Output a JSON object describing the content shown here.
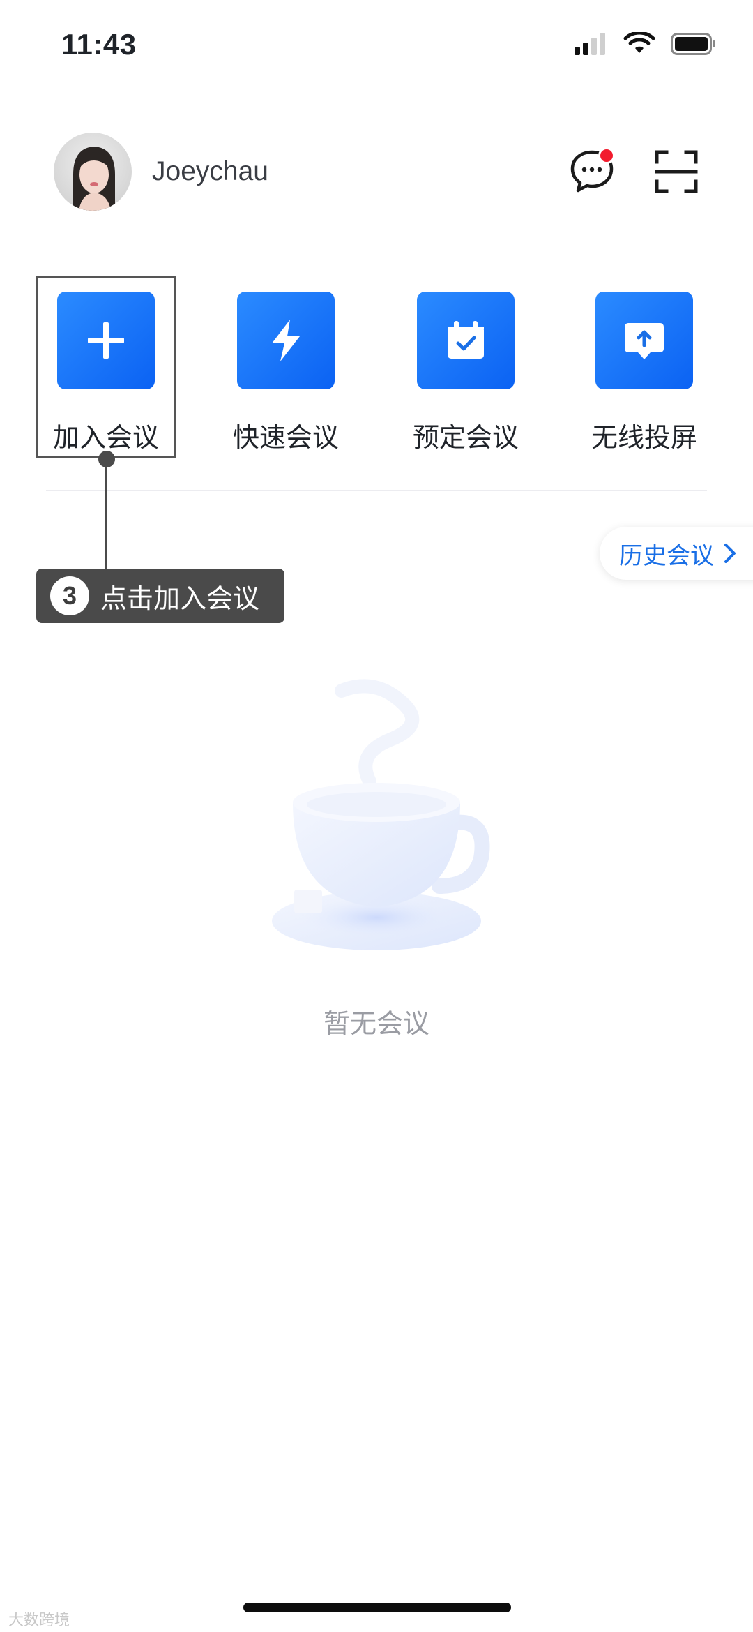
{
  "status_bar": {
    "time": "11:43"
  },
  "header": {
    "username": "Joeychau",
    "has_unread_messages": true,
    "icons": [
      "avatar",
      "message-icon",
      "scan-icon"
    ]
  },
  "actions": [
    {
      "label": "加入会议",
      "icon": "plus-icon"
    },
    {
      "label": "快速会议",
      "icon": "lightning-icon"
    },
    {
      "label": "预定会议",
      "icon": "calendar-icon"
    },
    {
      "label": "无线投屏",
      "icon": "screen-share-icon"
    }
  ],
  "history": {
    "label": "历史会议"
  },
  "annotation": {
    "step": "3",
    "text": "点击加入会议"
  },
  "empty_state": {
    "text": "暂无会议"
  },
  "watermark": {
    "text": "大数跨境"
  },
  "colors": {
    "accent": "#1a6fe6",
    "tile_gradient_start": "#2b8bff",
    "tile_gradient_end": "#0b62f3",
    "badge": "#f21b2d"
  }
}
